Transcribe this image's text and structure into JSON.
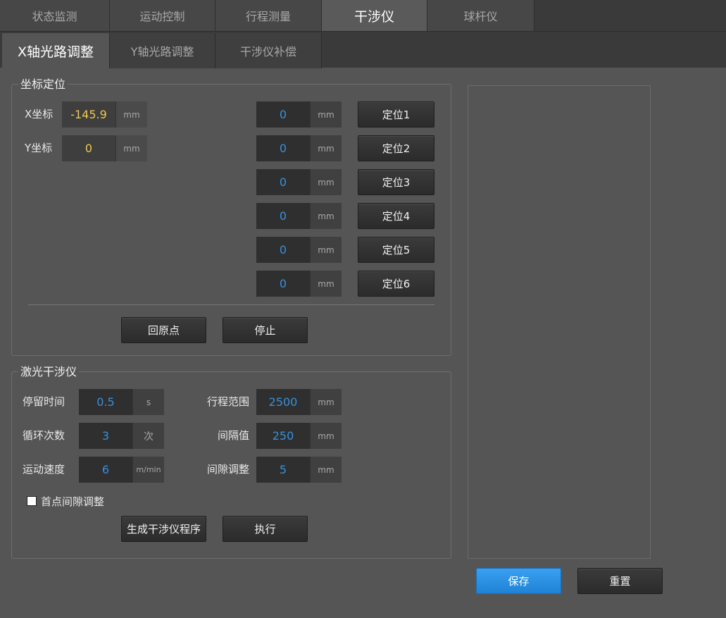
{
  "top_tabs": [
    "状态监测",
    "运动控制",
    "行程测量",
    "干涉仪",
    "球杆仪"
  ],
  "sub_tabs": [
    "X轴光路调整",
    "Y轴光路调整",
    "干涉仪补偿"
  ],
  "coord_group": {
    "title": "坐标定位",
    "x_label": "X坐标",
    "x_value": "-145.9",
    "x_unit": "mm",
    "y_label": "Y坐标",
    "y_value": "0",
    "y_unit": "mm",
    "positions": [
      {
        "value": "0",
        "unit": "mm",
        "button": "定位1"
      },
      {
        "value": "0",
        "unit": "mm",
        "button": "定位2"
      },
      {
        "value": "0",
        "unit": "mm",
        "button": "定位3"
      },
      {
        "value": "0",
        "unit": "mm",
        "button": "定位4"
      },
      {
        "value": "0",
        "unit": "mm",
        "button": "定位5"
      },
      {
        "value": "0",
        "unit": "mm",
        "button": "定位6"
      }
    ],
    "home_button": "回原点",
    "stop_button": "停止"
  },
  "laser_group": {
    "title": "激光干涉仪",
    "dwell": {
      "label": "停留时间",
      "value": "0.5",
      "unit": "s"
    },
    "cycles": {
      "label": "循环次数",
      "value": "3",
      "unit": "次"
    },
    "speed": {
      "label": "运动速度",
      "value": "6",
      "unit": "m/min"
    },
    "range": {
      "label": "行程范围",
      "value": "2500",
      "unit": "mm"
    },
    "interval": {
      "label": "间隔值",
      "value": "250",
      "unit": "mm"
    },
    "backlash": {
      "label": "间隙调整",
      "value": "5",
      "unit": "mm"
    },
    "checkbox_label": "首点间隙调整",
    "checkbox_checked": false,
    "generate_button": "生成干涉仪程序",
    "execute_button": "执行"
  },
  "footer": {
    "save_button": "保存",
    "reset_button": "重置"
  }
}
